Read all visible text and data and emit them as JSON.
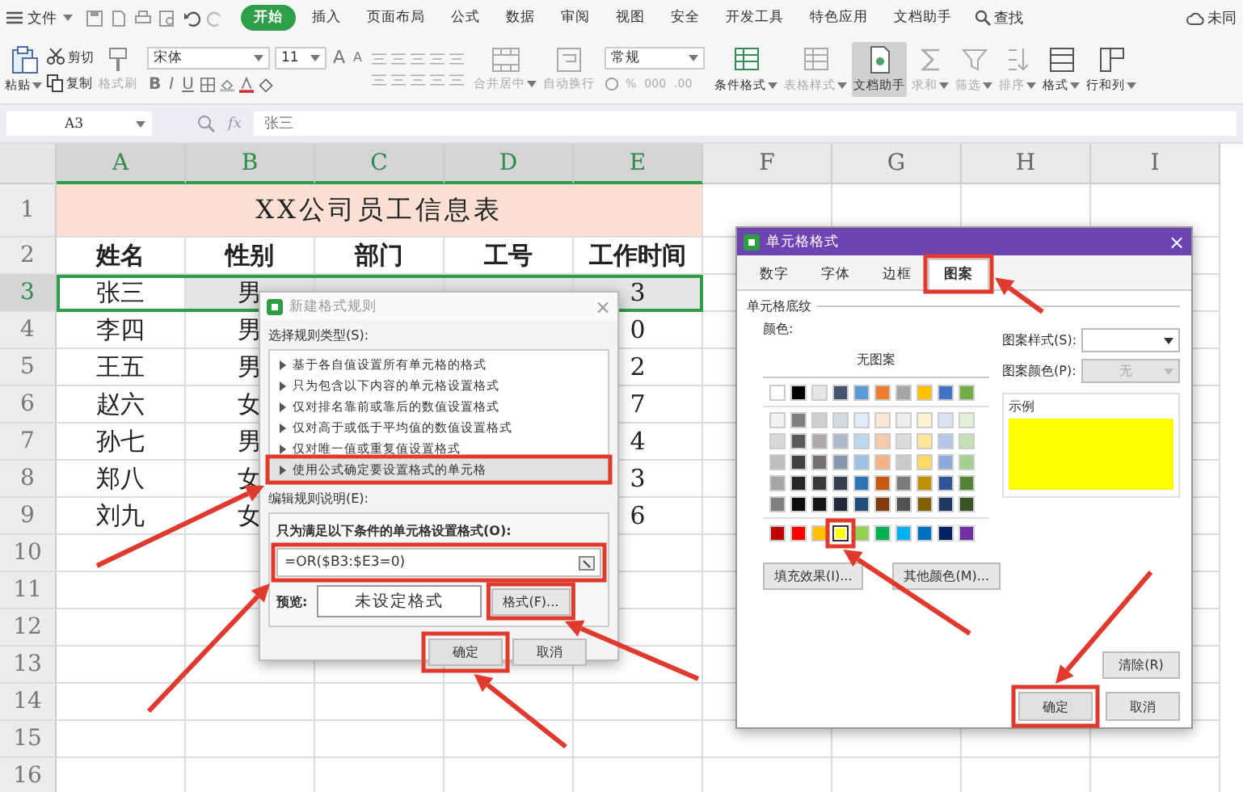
{
  "menubar": {
    "file_menu": "文件",
    "tabs": [
      {
        "label": "开始",
        "selected": true
      },
      {
        "label": "插入",
        "selected": false
      },
      {
        "label": "页面布局",
        "selected": false
      },
      {
        "label": "公式",
        "selected": false
      },
      {
        "label": "数据",
        "selected": false
      },
      {
        "label": "审阅",
        "selected": false
      },
      {
        "label": "视图",
        "selected": false
      },
      {
        "label": "安全",
        "selected": false
      },
      {
        "label": "开发工具",
        "selected": false
      },
      {
        "label": "特色应用",
        "selected": false
      },
      {
        "label": "文档助手",
        "selected": false
      }
    ],
    "search": "查找",
    "sync": "未同"
  },
  "ribbon": {
    "paste": "粘贴",
    "cut": "剪切",
    "copy": "复制",
    "painter": {
      "label": "格式刷",
      "disabled": true
    },
    "font_name": "宋体",
    "font_size": "11",
    "size_buttons": [
      "A",
      "A"
    ],
    "style_buttons": [
      "B",
      "I",
      "U"
    ],
    "merge": {
      "label": "合并居中",
      "disabled": true
    },
    "wrap": {
      "label": "自动换行",
      "disabled": true
    },
    "number_format": "常规",
    "number_buttons": [
      "%",
      "000",
      ".00"
    ],
    "tools": [
      {
        "label": "条件格式",
        "disabled": false,
        "selected": false,
        "dropdown": true
      },
      {
        "label": "表格样式",
        "disabled": true,
        "selected": false,
        "dropdown": true
      },
      {
        "label": "文档助手",
        "disabled": false,
        "selected": true,
        "dropdown": false
      },
      {
        "label": "求和",
        "disabled": true,
        "selected": false,
        "dropdown": true
      },
      {
        "label": "筛选",
        "disabled": true,
        "selected": false,
        "dropdown": true
      },
      {
        "label": "排序",
        "disabled": true,
        "selected": false,
        "dropdown": true
      },
      {
        "label": "格式",
        "disabled": false,
        "selected": false,
        "dropdown": true
      },
      {
        "label": "行和列",
        "disabled": false,
        "selected": false,
        "dropdown": true
      }
    ]
  },
  "formula_bar": {
    "cell": "A3",
    "fx": "fx",
    "value": "张三"
  },
  "sheet": {
    "columns": [
      {
        "label": "A",
        "selected": true
      },
      {
        "label": "B",
        "selected": true
      },
      {
        "label": "C",
        "selected": true
      },
      {
        "label": "D",
        "selected": true
      },
      {
        "label": "E",
        "selected": true
      },
      {
        "label": "F",
        "selected": false
      },
      {
        "label": "G",
        "selected": false
      },
      {
        "label": "H",
        "selected": false
      },
      {
        "label": "I",
        "selected": false
      }
    ],
    "row_headers": [
      {
        "label": "1",
        "selected": false
      },
      {
        "label": "2",
        "selected": false
      },
      {
        "label": "3",
        "selected": true
      },
      {
        "label": "4",
        "selected": false
      },
      {
        "label": "5",
        "selected": false
      },
      {
        "label": "6",
        "selected": false
      },
      {
        "label": "7",
        "selected": false
      },
      {
        "label": "8",
        "selected": false
      },
      {
        "label": "9",
        "selected": false
      },
      {
        "label": "10",
        "selected": false
      },
      {
        "label": "11",
        "selected": false
      },
      {
        "label": "12",
        "selected": false
      },
      {
        "label": "13",
        "selected": false
      },
      {
        "label": "14",
        "selected": false
      },
      {
        "label": "15",
        "selected": false
      },
      {
        "label": "16",
        "selected": false
      }
    ],
    "rows": [
      {
        "selected": false,
        "title": "XX公司员工信息表"
      },
      {
        "selected": false,
        "cells": {
          "A": "姓名",
          "B": "性别",
          "C": "部门",
          "D": "工号",
          "E": "工作时间"
        }
      },
      {
        "selected": true,
        "cells": {
          "A": "张三",
          "B": "男",
          "E": "3"
        }
      },
      {
        "selected": false,
        "cells": {
          "A": "李四",
          "B": "男",
          "E": "0"
        }
      },
      {
        "selected": false,
        "cells": {
          "A": "王五",
          "B": "男",
          "E": "2"
        }
      },
      {
        "selected": false,
        "cells": {
          "A": "赵六",
          "B": "女",
          "E": "7"
        }
      },
      {
        "selected": false,
        "cells": {
          "A": "孙七",
          "B": "男",
          "E": "4"
        }
      },
      {
        "selected": false,
        "cells": {
          "A": "郑八",
          "B": "女",
          "E": "3"
        }
      },
      {
        "selected": false,
        "cells": {
          "A": "刘九",
          "B": "女",
          "E": "6"
        }
      }
    ]
  },
  "rule_dialog": {
    "title": "新建格式规则",
    "close": "×",
    "type_label": "选择规则类型(S):",
    "rule_types": [
      {
        "label": "基于各自值设置所有单元格的格式",
        "selected": false
      },
      {
        "label": "只为包含以下内容的单元格设置格式",
        "selected": false
      },
      {
        "label": "仅对排名靠前或靠后的数值设置格式",
        "selected": false
      },
      {
        "label": "仅对高于或低于平均值的数值设置格式",
        "selected": false
      },
      {
        "label": "仅对唯一值或重复值设置格式",
        "selected": false
      },
      {
        "label": "使用公式确定要设置格式的单元格",
        "selected": true
      }
    ],
    "edit_label": "编辑规则说明(E):",
    "condition_label": "只为满足以下条件的单元格设置格式(O):",
    "formula": "=OR($B3:$E3=0)",
    "preview_label": "预览:",
    "preview_text": "未设定格式",
    "format_button": "格式(F)...",
    "ok": "确定",
    "cancel": "取消"
  },
  "format_dialog": {
    "title": "单元格格式",
    "close": "×",
    "tabs": [
      {
        "label": "数字",
        "selected": false
      },
      {
        "label": "字体",
        "selected": false
      },
      {
        "label": "边框",
        "selected": false
      },
      {
        "label": "图案",
        "selected": true
      }
    ],
    "group": "单元格底纹",
    "color_label": "颜色:",
    "no_pattern": "无图案",
    "palette": {
      "theme_row": [
        {
          "color": "#ffffff",
          "selected": false
        },
        {
          "color": "#000000",
          "selected": false
        },
        {
          "color": "#e7e6e6",
          "selected": false
        },
        {
          "color": "#44546a",
          "selected": false
        },
        {
          "color": "#5b9bd5",
          "selected": false
        },
        {
          "color": "#ed7d31",
          "selected": false
        },
        {
          "color": "#a5a5a5",
          "selected": false
        },
        {
          "color": "#ffc000",
          "selected": false
        },
        {
          "color": "#4472c4",
          "selected": false
        },
        {
          "color": "#70ad47",
          "selected": false
        }
      ],
      "tint_rows": [
        [
          {
            "color": "#f2f2f2",
            "selected": false
          },
          {
            "color": "#7f7f7f",
            "selected": false
          },
          {
            "color": "#d0cece",
            "selected": false
          },
          {
            "color": "#d6dce4",
            "selected": false
          },
          {
            "color": "#deebf6",
            "selected": false
          },
          {
            "color": "#fbe5d5",
            "selected": false
          },
          {
            "color": "#ededed",
            "selected": false
          },
          {
            "color": "#fff2cc",
            "selected": false
          },
          {
            "color": "#d9e2f3",
            "selected": false
          },
          {
            "color": "#e2efd9",
            "selected": false
          }
        ],
        [
          {
            "color": "#d8d8d8",
            "selected": false
          },
          {
            "color": "#595959",
            "selected": false
          },
          {
            "color": "#aeaaaa",
            "selected": false
          },
          {
            "color": "#adb9ca",
            "selected": false
          },
          {
            "color": "#bdd7ee",
            "selected": false
          },
          {
            "color": "#f7cbac",
            "selected": false
          },
          {
            "color": "#dbdbdb",
            "selected": false
          },
          {
            "color": "#fee599",
            "selected": false
          },
          {
            "color": "#b4c6e7",
            "selected": false
          },
          {
            "color": "#c5e0b3",
            "selected": false
          }
        ],
        [
          {
            "color": "#bfbfbf",
            "selected": false
          },
          {
            "color": "#3f3f3f",
            "selected": false
          },
          {
            "color": "#757070",
            "selected": false
          },
          {
            "color": "#8496b0",
            "selected": false
          },
          {
            "color": "#9cc3e5",
            "selected": false
          },
          {
            "color": "#f4b183",
            "selected": false
          },
          {
            "color": "#c9c9c9",
            "selected": false
          },
          {
            "color": "#ffd965",
            "selected": false
          },
          {
            "color": "#8eaadb",
            "selected": false
          },
          {
            "color": "#a8d08d",
            "selected": false
          }
        ],
        [
          {
            "color": "#a5a5a5",
            "selected": false
          },
          {
            "color": "#262626",
            "selected": false
          },
          {
            "color": "#3a3838",
            "selected": false
          },
          {
            "color": "#323f4f",
            "selected": false
          },
          {
            "color": "#2e75b5",
            "selected": false
          },
          {
            "color": "#c55a11",
            "selected": false
          },
          {
            "color": "#7b7b7b",
            "selected": false
          },
          {
            "color": "#bf9000",
            "selected": false
          },
          {
            "color": "#2f5496",
            "selected": false
          },
          {
            "color": "#538135",
            "selected": false
          }
        ],
        [
          {
            "color": "#7f7f7f",
            "selected": false
          },
          {
            "color": "#0c0c0c",
            "selected": false
          },
          {
            "color": "#171616",
            "selected": false
          },
          {
            "color": "#222a35",
            "selected": false
          },
          {
            "color": "#1e4e79",
            "selected": false
          },
          {
            "color": "#833c0b",
            "selected": false
          },
          {
            "color": "#525252",
            "selected": false
          },
          {
            "color": "#7f6000",
            "selected": false
          },
          {
            "color": "#1f3864",
            "selected": false
          },
          {
            "color": "#375623",
            "selected": false
          }
        ]
      ],
      "standard_row": [
        {
          "color": "#c00000",
          "selected": false
        },
        {
          "color": "#ff0000",
          "selected": false
        },
        {
          "color": "#ffc000",
          "selected": false
        },
        {
          "color": "#ffff00",
          "selected": true
        },
        {
          "color": "#92d050",
          "selected": false
        },
        {
          "color": "#00b050",
          "selected": false
        },
        {
          "color": "#00b0f0",
          "selected": false
        },
        {
          "color": "#0070c0",
          "selected": false
        },
        {
          "color": "#002060",
          "selected": false
        },
        {
          "color": "#7030a0",
          "selected": false
        }
      ]
    },
    "fill_effects": "填充效果(I)...",
    "more_colors": "其他颜色(M)...",
    "pattern_style_label": "图案样式(S):",
    "pattern_color_label": "图案颜色(P):",
    "pattern_color_value": "无",
    "sample_label": "示例",
    "clear": "清除(R)",
    "ok": "确定",
    "cancel": "取消"
  }
}
